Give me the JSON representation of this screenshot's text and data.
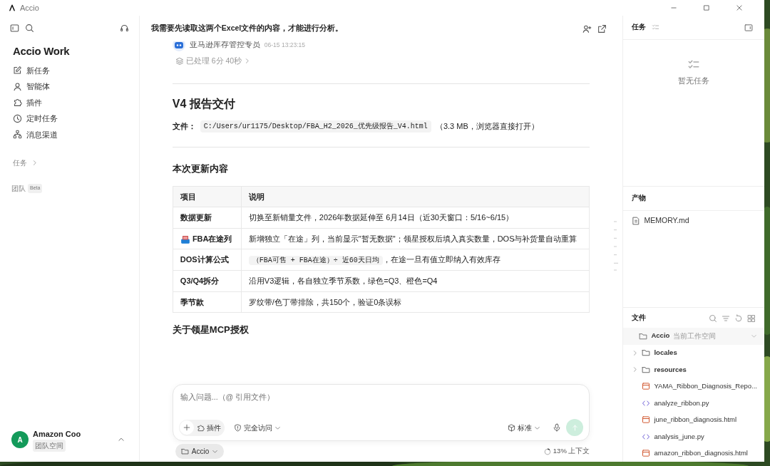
{
  "window": {
    "title": "Accio"
  },
  "sidebar": {
    "brand": "Accio Work",
    "items": [
      {
        "label": "新任务"
      },
      {
        "label": "智能体"
      },
      {
        "label": "插件"
      },
      {
        "label": "定时任务"
      },
      {
        "label": "消息渠道"
      }
    ],
    "tasks_label": "任务",
    "team_label": "团队",
    "team_badge": "Beta",
    "user": {
      "initial": "A",
      "name": "Amazon Coo",
      "workspace": "团队空间"
    }
  },
  "chat": {
    "title": "我需要先读取这两个Excel文件的内容，才能进行分析。",
    "agent": {
      "name": "亚马逊库存管控专员",
      "time": "06-15 13:23:15"
    },
    "processed": "已处理 6分 40秒",
    "heading": "V4 报告交付",
    "file_label": "文件：",
    "file_path": "C:/Users/ur1175/Desktop/FBA_H2_2026_优先级报告_V4.html",
    "file_note": "（3.3 MB，浏览器直接打开）",
    "section": "本次更新内容",
    "table": {
      "columns": [
        "项目",
        "说明"
      ],
      "rows": [
        {
          "item": "数据更新",
          "text": "切换至新销量文件，2026年数据延伸至 6月14日（近30天窗口：5/16~6/15）"
        },
        {
          "item": "FBA在途列",
          "has_icon": true,
          "text": "新增独立「在途」列，当前显示\"暂无数据\"；领星授权后填入真实数量，DOS与补货量自动重算"
        },
        {
          "item": "DOS计算公式",
          "code": "（FBA可售 + FBA在途）÷ 近60天日均",
          "text": "，在途一旦有值立即纳入有效库存"
        },
        {
          "item": "Q3/Q4拆分",
          "text": "沿用V3逻辑，各自独立季节系数，绿色=Q3、橙色=Q4"
        },
        {
          "item": "季节款",
          "text": "罗纹带/色丁带排除，共150个，验证0条误标"
        }
      ]
    },
    "next_heading": "关于领星MCP授权"
  },
  "composer": {
    "placeholder": "输入问题...（@ 引用文件）",
    "plugin": "插件",
    "access": "完全访问",
    "mode": "标准",
    "workspace": "Accio",
    "context": "13% 上下文"
  },
  "panel": {
    "tasks_title": "任务",
    "tasks_empty": "暂无任务",
    "outputs_title": "产物",
    "outputs": [
      {
        "name": "MEMORY.md"
      }
    ],
    "files_title": "文件",
    "workspace": {
      "name": "Accio",
      "note": "当前工作空间"
    },
    "files": [
      {
        "name": "locales",
        "kind": "folder"
      },
      {
        "name": "resources",
        "kind": "folder"
      },
      {
        "name": "YAMA_Ribbon_Diagnosis_Repo...",
        "kind": "html"
      },
      {
        "name": "analyze_ribbon.py",
        "kind": "py"
      },
      {
        "name": "june_ribbon_diagnosis.html",
        "kind": "html"
      },
      {
        "name": "analysis_june.py",
        "kind": "py"
      },
      {
        "name": "amazon_ribbon_diagnosis.html",
        "kind": "html"
      }
    ]
  }
}
